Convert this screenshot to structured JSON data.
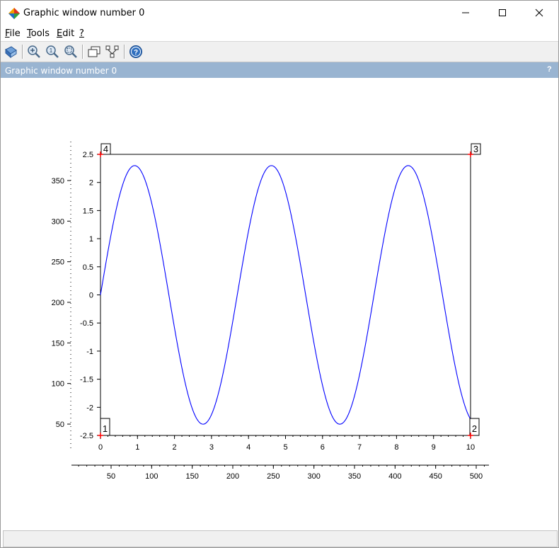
{
  "window": {
    "title": "Graphic window number 0",
    "dock_title": "Graphic window number 0",
    "dock_help": "?"
  },
  "menu": {
    "file": {
      "key": "F",
      "rest": "ile"
    },
    "tools": {
      "key": "T",
      "rest": "ools"
    },
    "edit": {
      "key": "E",
      "rest": "dit"
    },
    "help": {
      "key": "?",
      "rest": ""
    }
  },
  "toolbar": {
    "items": [
      "rotate-icon",
      "zoom-in-icon",
      "zoom-reset-icon",
      "zoom-area-icon",
      "window-icon",
      "datatip-icon",
      "help-icon"
    ]
  },
  "colors": {
    "curve": "#0000ff",
    "marker": "#ff0000",
    "dock": "#99b4d1"
  },
  "chart_data": [
    {
      "type": "line",
      "description_axes": "inner",
      "x": [
        0,
        1,
        2,
        3,
        4,
        5,
        6,
        7,
        8,
        9,
        10
      ],
      "function": "2.3*sin(1.7*x)",
      "series": [
        {
          "name": "",
          "x": [
            0,
            0.25,
            0.5,
            0.75,
            1,
            1.25,
            1.5,
            1.75,
            2,
            2.25,
            2.5,
            2.75,
            3,
            3.25,
            3.5,
            3.75,
            4,
            4.25,
            4.5,
            4.75,
            5,
            5.25,
            5.5,
            5.75,
            6,
            6.25,
            6.5,
            6.75,
            7,
            7.25,
            7.5,
            7.75,
            8,
            8.25,
            8.5,
            8.75,
            9,
            9.25,
            9.5,
            9.75,
            10
          ],
          "y": [
            0,
            0.95,
            1.76,
            2.22,
            2.28,
            1.92,
            1.29,
            0.42,
            -0.5,
            -1.39,
            -2.04,
            -2.3,
            -2.13,
            -1.55,
            -0.72,
            0.23,
            1.14,
            1.86,
            2.27,
            2.25,
            1.83,
            1.08,
            0.14,
            -0.79,
            -1.61,
            -2.16,
            -2.3,
            -2.01,
            -1.33,
            -0.46,
            0.47,
            1.37,
            2.02,
            2.3,
            2.14,
            1.57,
            0.73,
            -0.22,
            -1.13,
            -1.85,
            -2.27
          ]
        }
      ],
      "xlim": [
        0,
        10
      ],
      "ylim": [
        -2.5,
        2.5
      ],
      "xticks": [
        "0",
        "1",
        "2",
        "3",
        "4",
        "5",
        "6",
        "7",
        "8",
        "9",
        "10"
      ],
      "yticks": [
        "-2.5",
        "-2",
        "-1.5",
        "-1",
        "-0.5",
        "0",
        "0.5",
        "1",
        "1.5",
        "2",
        "2.5"
      ],
      "corner_labels": [
        "1",
        "2",
        "3",
        "4"
      ],
      "grid": false
    },
    {
      "type": "axes",
      "description_axes": "outer pixel rulers",
      "xticks": [
        "50",
        "100",
        "150",
        "200",
        "250",
        "300",
        "350",
        "400",
        "450",
        "500"
      ],
      "yticks": [
        "50",
        "100",
        "150",
        "200",
        "250",
        "300",
        "350"
      ]
    }
  ],
  "statusbar": {
    "text": ""
  }
}
